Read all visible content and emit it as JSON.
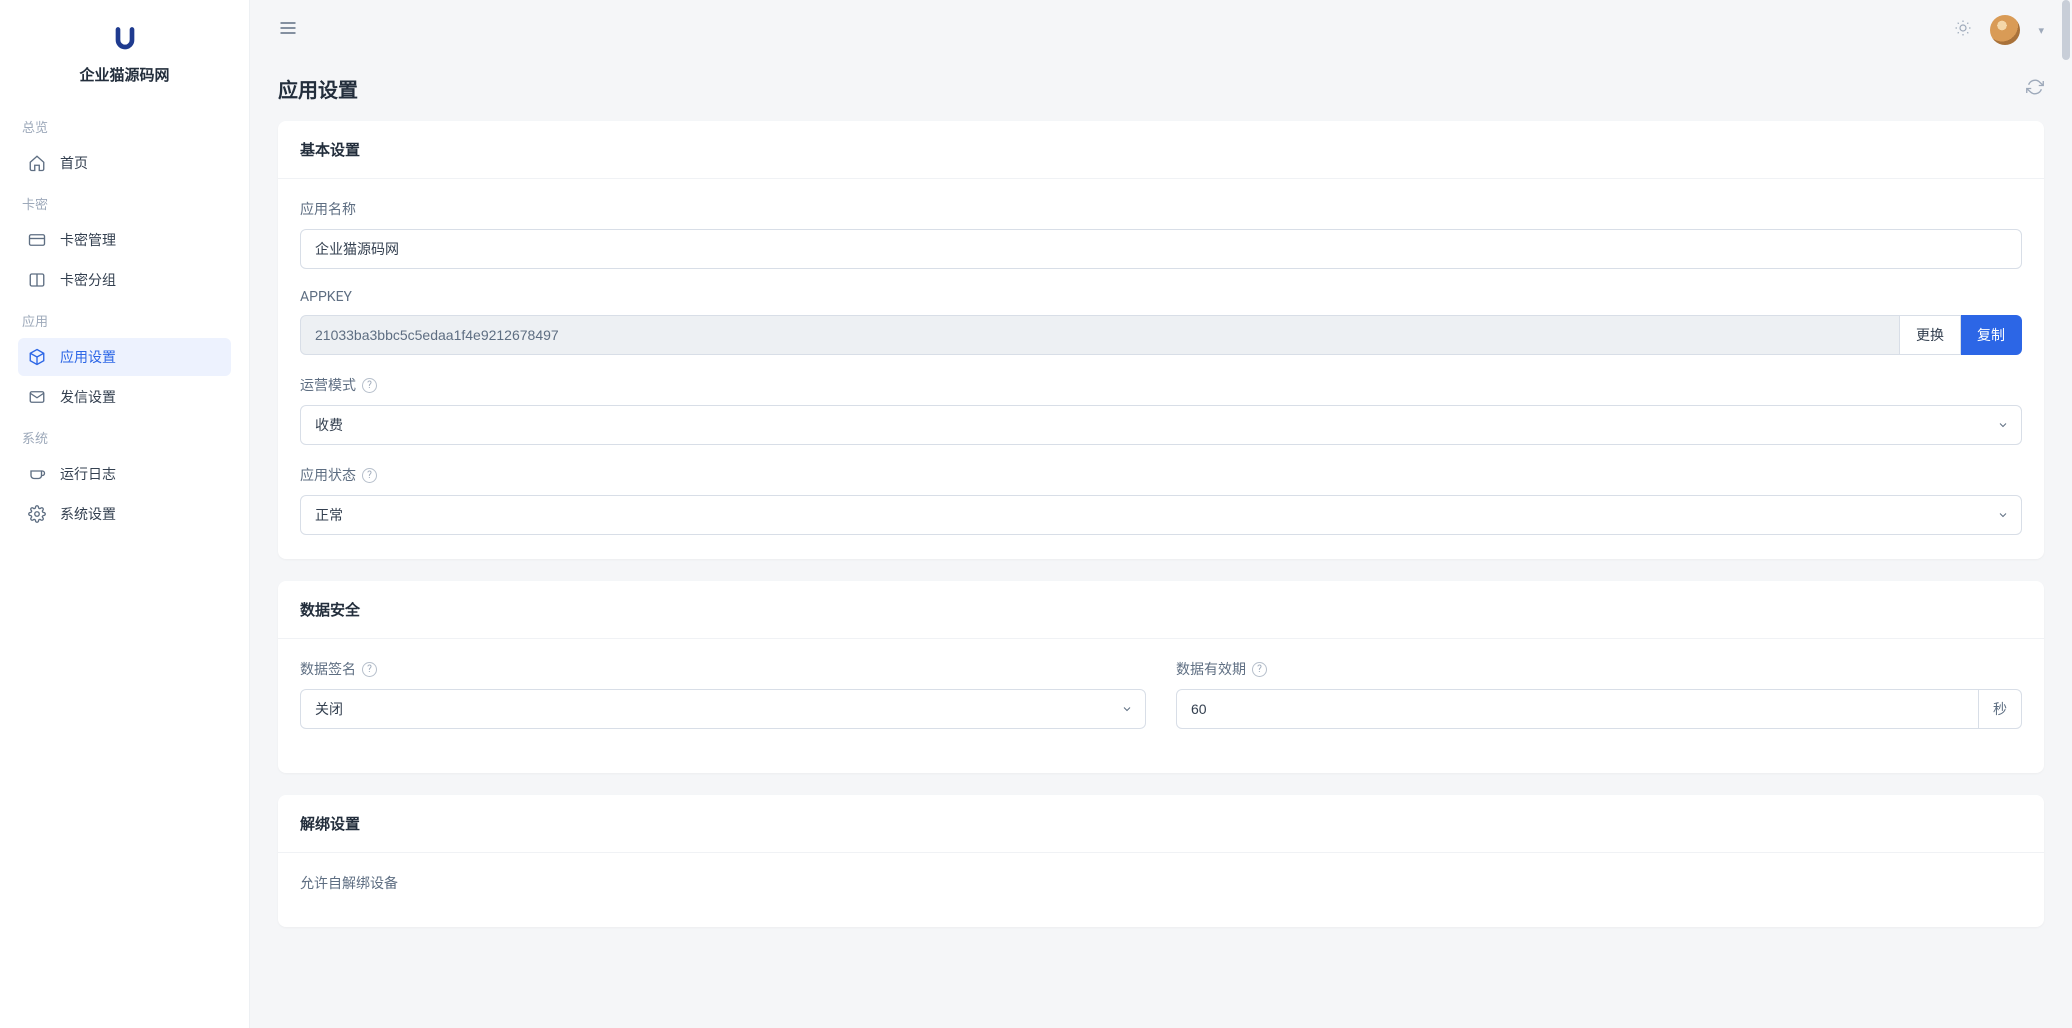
{
  "brand": {
    "name": "企业猫源码网"
  },
  "sidebar": {
    "sections": [
      {
        "heading": "总览",
        "items": [
          {
            "id": "home",
            "label": "首页",
            "icon": "home",
            "active": false
          }
        ]
      },
      {
        "heading": "卡密",
        "items": [
          {
            "id": "card-manage",
            "label": "卡密管理",
            "icon": "card",
            "active": false
          },
          {
            "id": "card-group",
            "label": "卡密分组",
            "icon": "columns",
            "active": false
          }
        ]
      },
      {
        "heading": "应用",
        "items": [
          {
            "id": "app-settings",
            "label": "应用设置",
            "icon": "cube",
            "active": true
          },
          {
            "id": "mail-settings",
            "label": "发信设置",
            "icon": "mail",
            "active": false
          }
        ]
      },
      {
        "heading": "系统",
        "items": [
          {
            "id": "logs",
            "label": "运行日志",
            "icon": "coffee",
            "active": false
          },
          {
            "id": "sys-settings",
            "label": "系统设置",
            "icon": "gear",
            "active": false
          }
        ]
      }
    ]
  },
  "page": {
    "title": "应用设置"
  },
  "basic": {
    "heading": "基本设置",
    "appNameLabel": "应用名称",
    "appNameValue": "企业猫源码网",
    "appkeyLabel": "APPKEY",
    "appkeyValue": "21033ba3bbc5c5edaa1f4e9212678497",
    "changeBtn": "更换",
    "copyBtn": "复制",
    "modeLabel": "运营模式",
    "modeValue": "收费",
    "statusLabel": "应用状态",
    "statusValue": "正常"
  },
  "security": {
    "heading": "数据安全",
    "signLabel": "数据签名",
    "signValue": "关闭",
    "ttlLabel": "数据有效期",
    "ttlValue": "60",
    "ttlUnit": "秒"
  },
  "unbind": {
    "heading": "解绑设置",
    "allowLabel": "允许自解绑设备"
  },
  "icons": {
    "home": "home-icon",
    "card": "card-icon",
    "columns": "columns-icon",
    "cube": "cube-icon",
    "mail": "mail-icon",
    "coffee": "coffee-icon",
    "gear": "gear-icon"
  }
}
